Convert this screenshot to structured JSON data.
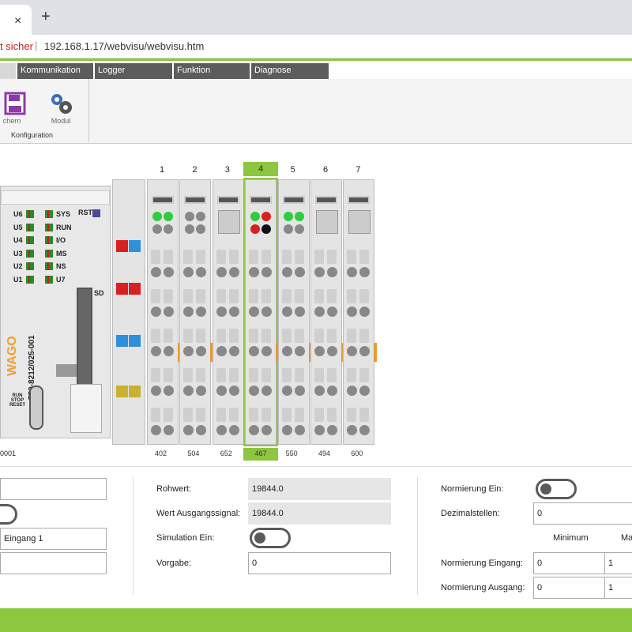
{
  "browser": {
    "tab_close": "×",
    "new_tab": "+",
    "insecure_label": "t sicher",
    "separator": "|",
    "url": "192.168.1.17/webvisu/webvisu.htm"
  },
  "menu": {
    "items": [
      "Kommunikation",
      "Logger",
      "Funktion",
      "Diagnose"
    ]
  },
  "ribbon": {
    "save_label": "chern",
    "module_label": "Modul",
    "group_label": "Konfiguration"
  },
  "controller": {
    "leds_left": [
      "U6",
      "U5",
      "U4",
      "U3",
      "U2",
      "U1"
    ],
    "leds_right": [
      "SYS",
      "RUN",
      "I/O",
      "MS",
      "NS",
      "U7"
    ],
    "rst_label": "RST",
    "sd_label": "SD",
    "brand": "WAGO",
    "model": "750-8212/025-001",
    "switch_label": "RUN STOP RESET",
    "bottom_label": "0001"
  },
  "modules": [
    {
      "num": "1",
      "label": "402",
      "selected": false
    },
    {
      "num": "2",
      "label": "504",
      "selected": false
    },
    {
      "num": "3",
      "label": "652",
      "selected": false
    },
    {
      "num": "4",
      "label": "467",
      "selected": true
    },
    {
      "num": "5",
      "label": "550",
      "selected": false
    },
    {
      "num": "6",
      "label": "494",
      "selected": false
    },
    {
      "num": "7",
      "label": "600",
      "selected": false
    }
  ],
  "panel": {
    "left_field_3": "Eingang 1",
    "rohwert_label": "Rohwert:",
    "rohwert_value": "19844.0",
    "wert_label": "Wert Ausgangssignal:",
    "wert_value": "19844.0",
    "simulation_label": "Simulation Ein:",
    "vorgabe_label": "Vorgabe:",
    "vorgabe_value": "0",
    "normierung_ein_label": "Normierung Ein:",
    "dezimal_label": "Dezimalstellen:",
    "dezimal_value": "0",
    "minimum_header": "Minimum",
    "maximum_header": "Ma",
    "norm_eingang_label": "Normierung Eingang:",
    "norm_eingang_min": "0",
    "norm_eingang_max": "1",
    "norm_ausgang_label": "Normierung Ausgang:",
    "norm_ausgang_min": "0",
    "norm_ausgang_max": "1"
  },
  "colors": {
    "accent": "#8dc63f",
    "menu": "#5c5c5c"
  }
}
